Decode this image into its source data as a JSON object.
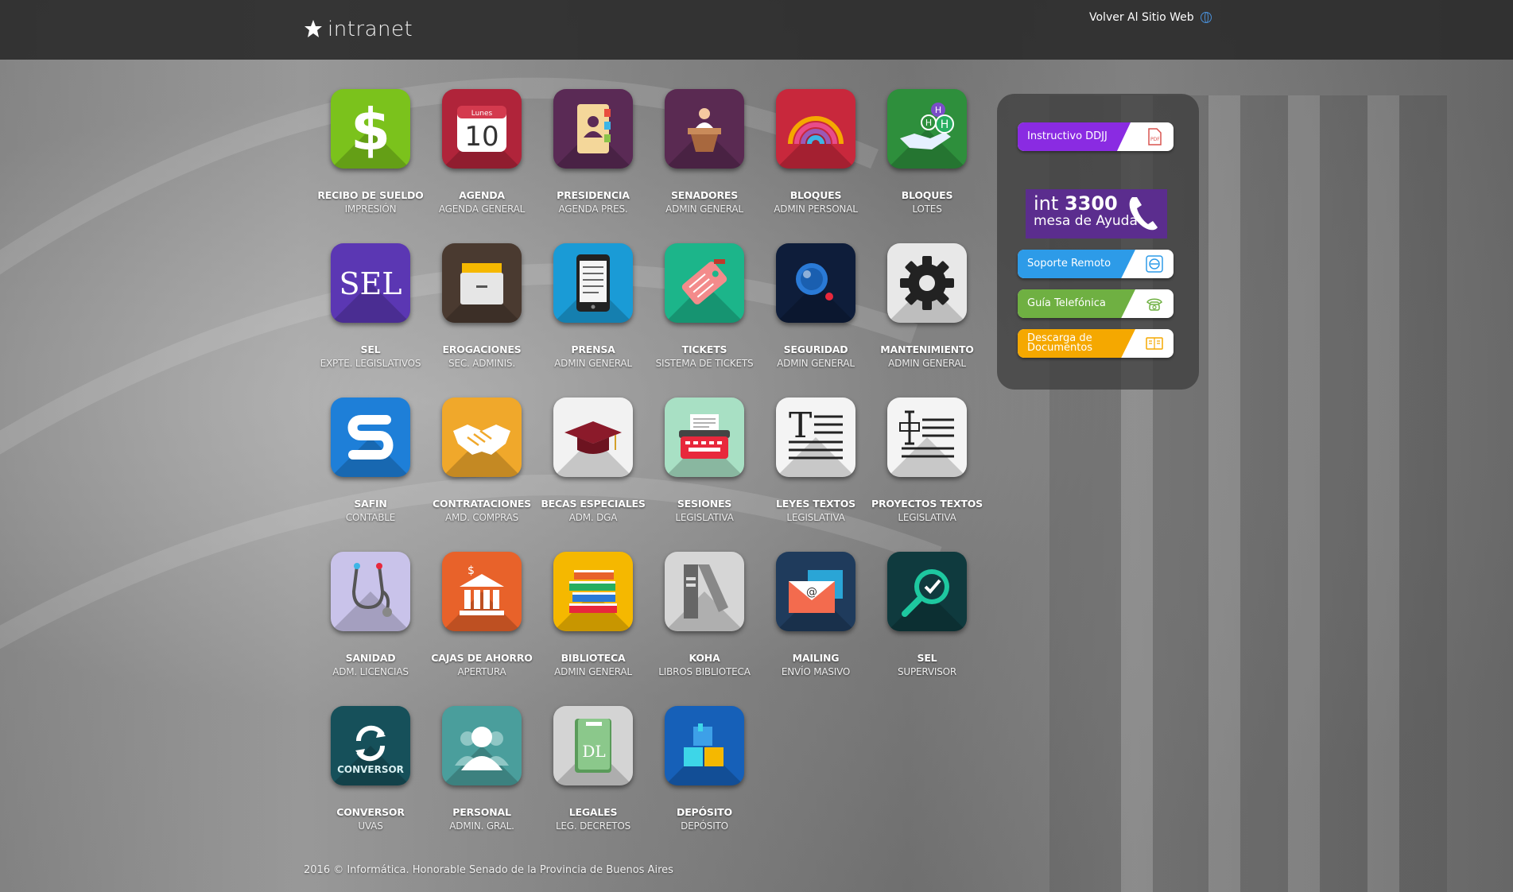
{
  "header": {
    "logo_text": "intranet",
    "back_link": "Volver Al Sitio Web"
  },
  "apps": [
    {
      "title": "RECIBO DE SUELDO",
      "subtitle": "IMPRESIÓN",
      "icon": "dollar-icon",
      "color": "#7bc21c"
    },
    {
      "title": "AGENDA",
      "subtitle": "AGENDA GENERAL",
      "icon": "calendar-icon",
      "color": "#b0243a",
      "glyph_top": "Lunes",
      "glyph_main": "10"
    },
    {
      "title": "PRESIDENCIA",
      "subtitle": "AGENDA PRES.",
      "icon": "address-book-icon",
      "color": "#5a2a55"
    },
    {
      "title": "SENADORES",
      "subtitle": "ADMIN GENERAL",
      "icon": "podium-icon",
      "color": "#5a2a52"
    },
    {
      "title": "BLOQUES",
      "subtitle": "ADMIN PERSONAL",
      "icon": "rainbow-icon",
      "color": "#c8283c"
    },
    {
      "title": "BLOQUES",
      "subtitle": "LOTES",
      "icon": "hand-molecule-icon",
      "color": "#2e8f3c"
    },
    {
      "title": "SEL",
      "subtitle": "EXPTE. LEGISLATIVOS",
      "icon": "sel-text-icon",
      "color": "#5b37b3",
      "glyph_main": "SEL"
    },
    {
      "title": "EROGACIONES",
      "subtitle": "SEC. ADMINIS.",
      "icon": "file-box-icon",
      "color": "#4a3a30"
    },
    {
      "title": "PRENSA",
      "subtitle": "ADMIN GENERAL",
      "icon": "ereader-icon",
      "color": "#1a9bd6"
    },
    {
      "title": "TICKETS",
      "subtitle": "SISTEMA DE TICKETS",
      "icon": "ticket-tag-icon",
      "color": "#1cb58a"
    },
    {
      "title": "SEGURIDAD",
      "subtitle": "ADMIN GENERAL",
      "icon": "camera-lens-icon",
      "color": "#0e1d3a"
    },
    {
      "title": "MANTENIMIENTO",
      "subtitle": "ADMIN GENERAL",
      "icon": "gear-icon",
      "color": "#e8e8e8"
    },
    {
      "title": "SAFIN",
      "subtitle": "CONTABLE",
      "icon": "safin-s-icon",
      "color": "#1e7fd8"
    },
    {
      "title": "CONTRATACIONES",
      "subtitle": "AMD. COMPRAS",
      "icon": "handshake-icon",
      "color": "#f0a82b"
    },
    {
      "title": "BECAS ESPECIALES",
      "subtitle": "ADM. DGA",
      "icon": "graduation-cap-icon",
      "color": "#f2f2f2"
    },
    {
      "title": "SESIONES",
      "subtitle": "LEGISLATIVA",
      "icon": "typewriter-icon",
      "color": "#a8e0c4"
    },
    {
      "title": "LEYES TEXTOS",
      "subtitle": "LEGISLATIVA",
      "icon": "text-document-icon",
      "color": "#f4f4f4"
    },
    {
      "title": "PROYECTOS TEXTOS",
      "subtitle": "LEGISLATIVA",
      "icon": "text-cursor-icon",
      "color": "#f4f4f4"
    },
    {
      "title": "SANIDAD",
      "subtitle": "ADM. LICENCIAS",
      "icon": "stethoscope-icon",
      "color": "#c9c3ea"
    },
    {
      "title": "CAJAS DE AHORRO",
      "subtitle": "APERTURA",
      "icon": "bank-icon",
      "color": "#e8622a"
    },
    {
      "title": "BIBLIOTECA",
      "subtitle": "ADMIN GENERAL",
      "icon": "books-icon",
      "color": "#f5b800"
    },
    {
      "title": "KOHA",
      "subtitle": "LIBROS BIBLIOTECA",
      "icon": "koha-book-icon",
      "color": "#d6d6d6"
    },
    {
      "title": "MAILING",
      "subtitle": "ENVÍO MASIVO",
      "icon": "mail-envelope-icon",
      "color": "#1f3b5c"
    },
    {
      "title": "SEL",
      "subtitle": "SUPERVISOR",
      "icon": "magnifier-check-icon",
      "color": "#0f3a3e"
    },
    {
      "title": "CONVERSOR",
      "subtitle": "UVAS",
      "icon": "convert-arrows-icon",
      "color": "#16505a",
      "glyph_main": "CONVERSOR"
    },
    {
      "title": "PERSONAL",
      "subtitle": "ADMIN. GRAL.",
      "icon": "people-icon",
      "color": "#4a9e9c"
    },
    {
      "title": "LEGALES",
      "subtitle": "LEG. DECRETOS",
      "icon": "dl-book-icon",
      "color": "#d4d4d4",
      "glyph_main": "DL"
    },
    {
      "title": "DEPÓSITO",
      "subtitle": "DEPÓSITO",
      "icon": "boxes-icon",
      "color": "#1660b8"
    }
  ],
  "sidebar": {
    "ddjj": {
      "label": "Instructivo DDJJ",
      "color": "#8a2be2",
      "icon": "pdf-icon"
    },
    "help": {
      "line1_pre": "int",
      "line1_num": "3300",
      "line2": "mesa de Ayuda",
      "icon": "phone-handset-icon",
      "color": "#5b2d8e"
    },
    "remote": {
      "label": "Soporte Remoto",
      "color": "#2d9be8",
      "icon": "remote-support-icon"
    },
    "phonebook": {
      "label": "Guía Telefónica",
      "color": "#6fb042",
      "icon": "telephone-icon"
    },
    "docs": {
      "label": "Descarga de Documentos",
      "color": "#f5a800",
      "icon": "documents-icon"
    }
  },
  "footer": {
    "text": "2016 © Informática. Honorable Senado de la Provincia de Buenos Aires"
  }
}
